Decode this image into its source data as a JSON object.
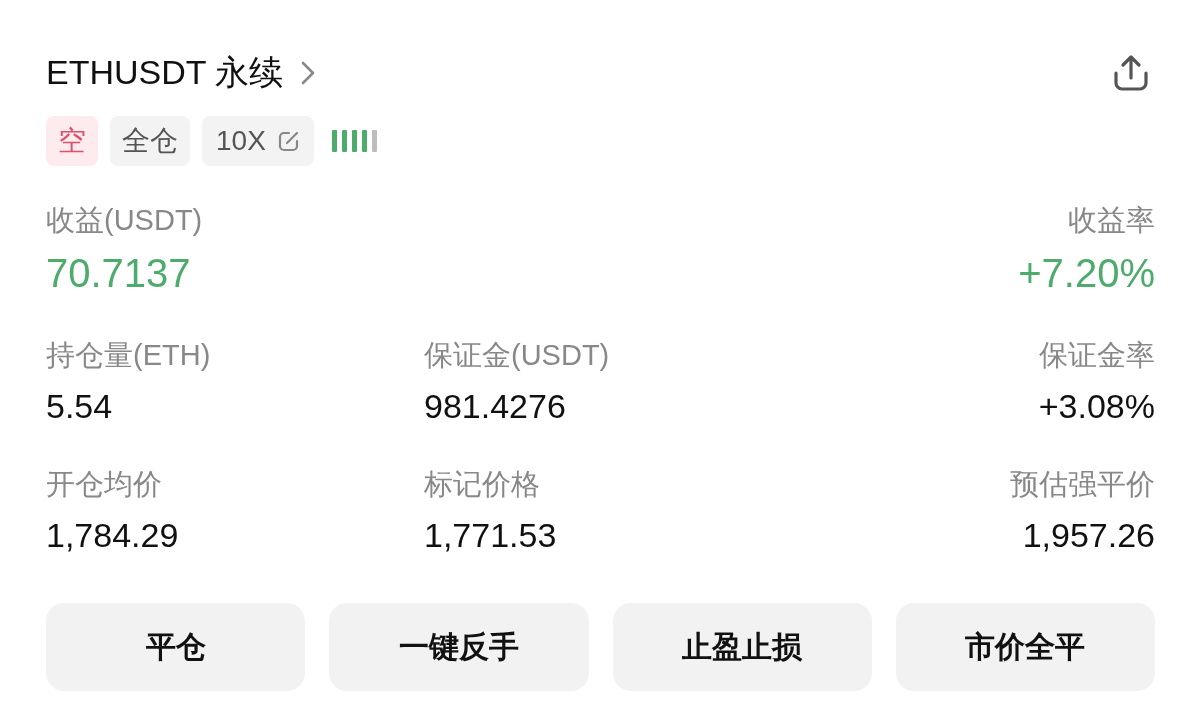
{
  "header": {
    "title": "ETHUSDT 永续"
  },
  "tags": [
    {
      "kind": "side",
      "label": "空"
    },
    {
      "kind": "plain",
      "label": "全仓"
    },
    {
      "kind": "leverage",
      "label": "10X"
    }
  ],
  "risk_meter": {
    "level": 0.8
  },
  "pnl": [
    {
      "label": "收益(USDT)",
      "value": "70.7137"
    },
    {
      "label": "收益率",
      "value": "+7.20%"
    }
  ],
  "stats": [
    [
      {
        "label": "持仓量(ETH)",
        "value": "5.54"
      },
      {
        "label": "保证金(USDT)",
        "value": "981.4276"
      },
      {
        "label": "保证金率",
        "value": "+3.08%"
      }
    ],
    [
      {
        "label": "开仓均价",
        "value": "1,784.29"
      },
      {
        "label": "标记价格",
        "value": "1,771.53"
      },
      {
        "label": "预估强平价",
        "value": "1,957.26"
      }
    ]
  ],
  "buttons": [
    "平仓",
    "一键反手",
    "止盈止损",
    "市价全平"
  ]
}
